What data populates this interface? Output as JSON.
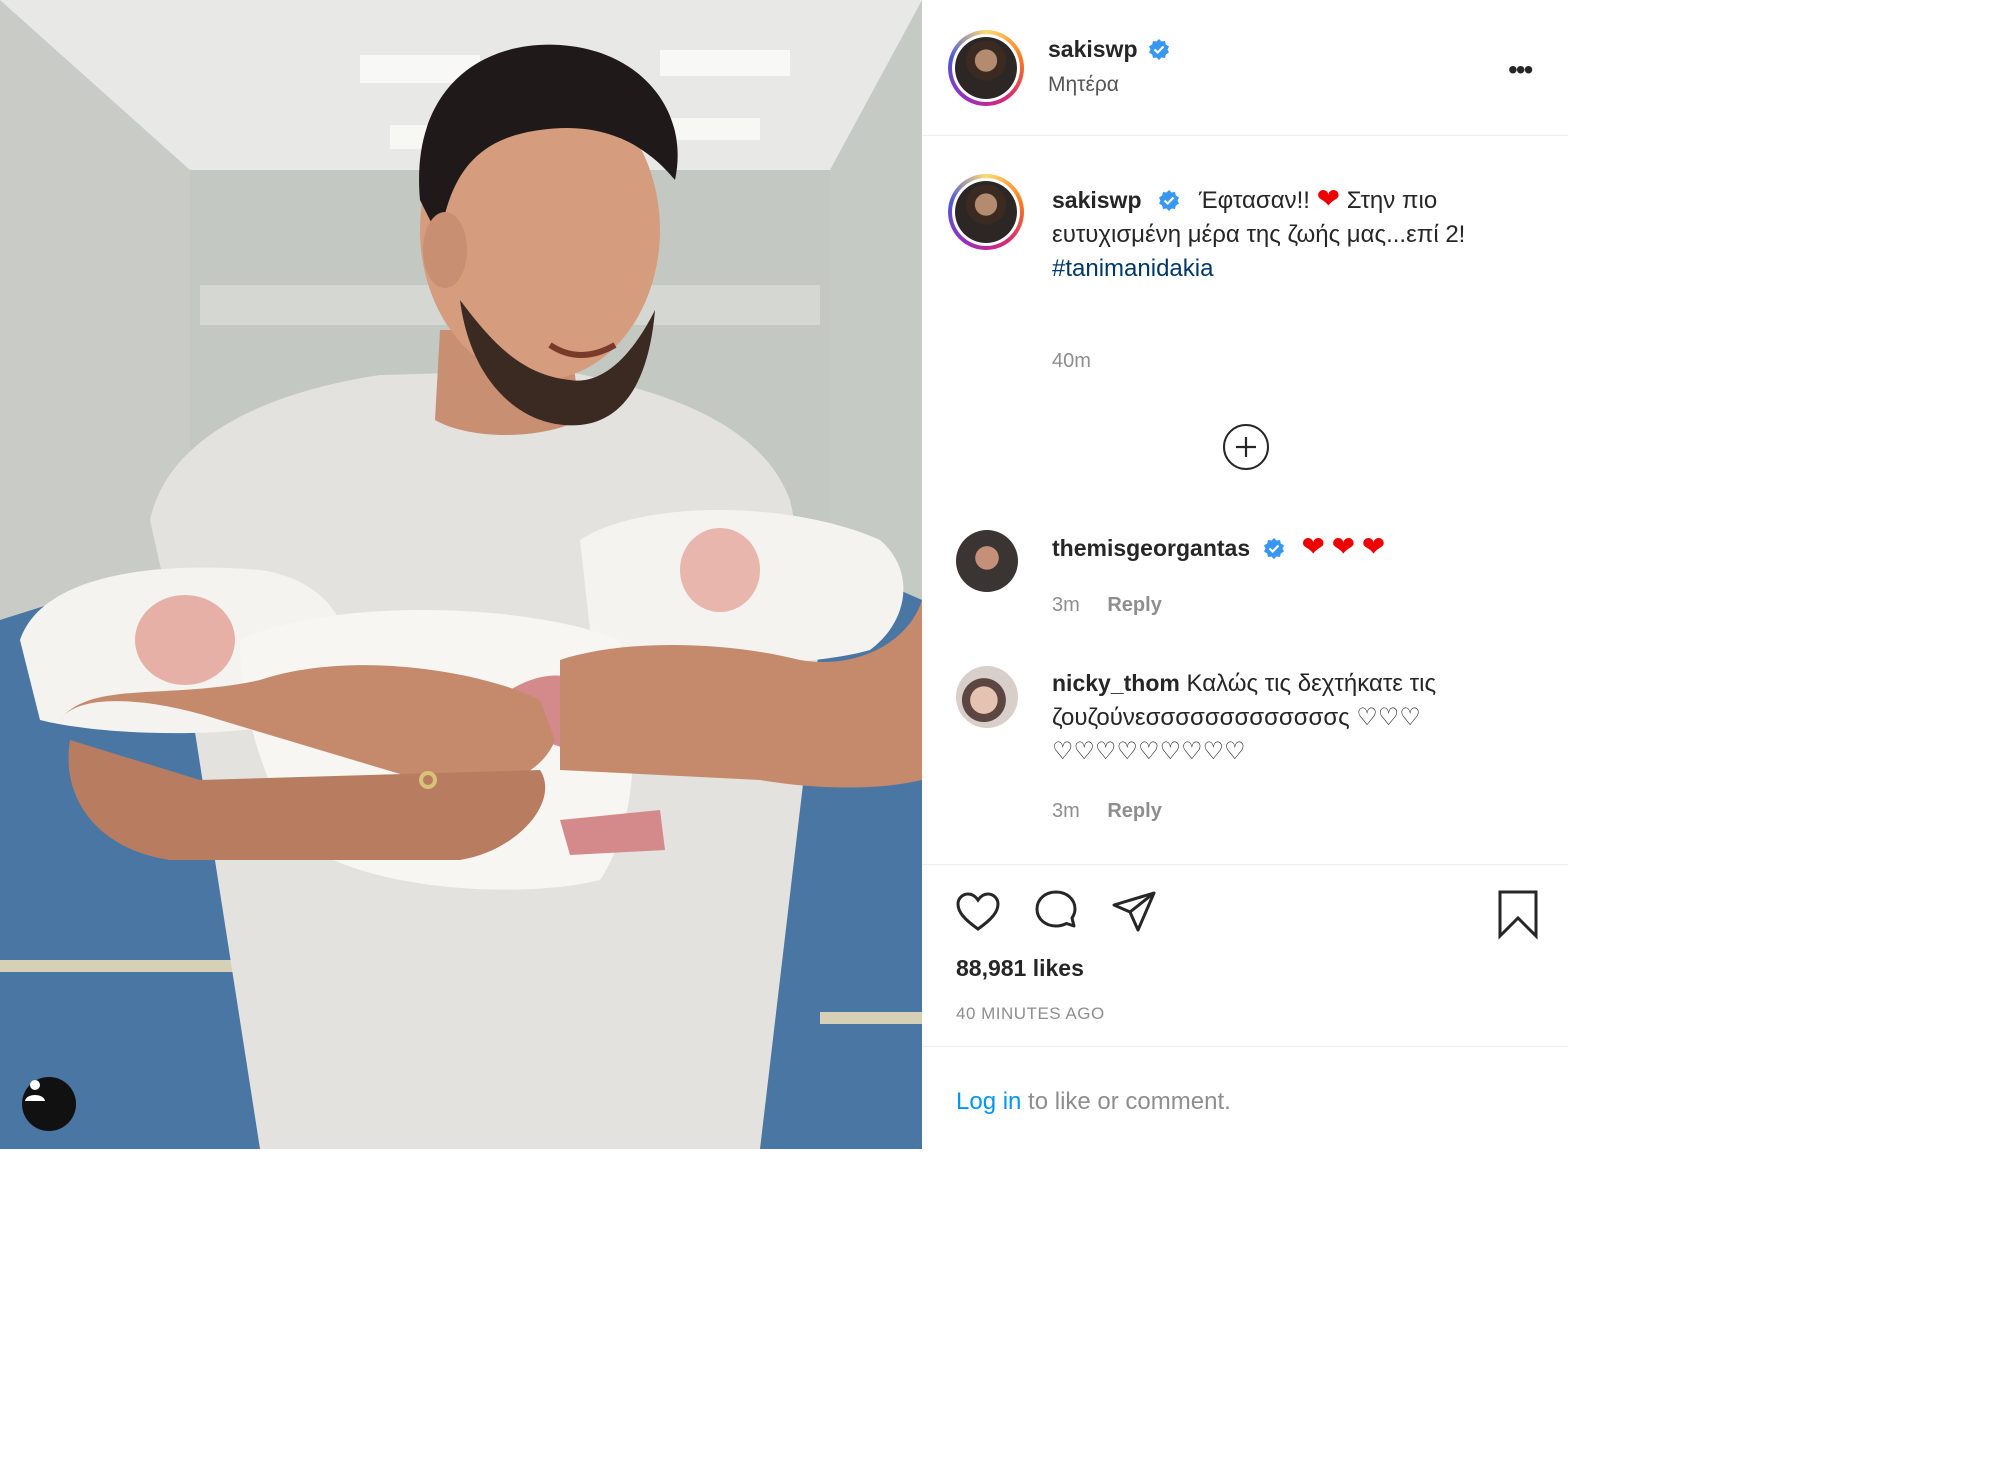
{
  "header": {
    "username": "sakiswp",
    "location": "Μητέρα"
  },
  "caption": {
    "username": "sakiswp",
    "text_1": "Έφτασαν!!",
    "text_2": "Στην πιο ευτυχισμένη μέρα της ζωής μας...επί 2!",
    "hashtag": "#tanimanidakia",
    "time": "40m"
  },
  "comments": [
    {
      "username": "themisgeorgantas",
      "text": "",
      "time": "3m",
      "reply": "Reply"
    },
    {
      "username": "nicky_thom",
      "text": "Καλώς τις δεχτήκατε τις ζουζούνεσσσσσσσσσσσσσς ♡♡♡ ♡♡♡♡♡♡♡♡♡",
      "time": "3m",
      "reply": "Reply"
    }
  ],
  "footer": {
    "likes": "88,981 likes",
    "ago": "40 MINUTES AGO",
    "login_link": "Log in",
    "login_rest": " to like or comment."
  },
  "colors": {
    "verified": "#3897f0",
    "link": "#00376b",
    "heart": "#ed4956"
  }
}
